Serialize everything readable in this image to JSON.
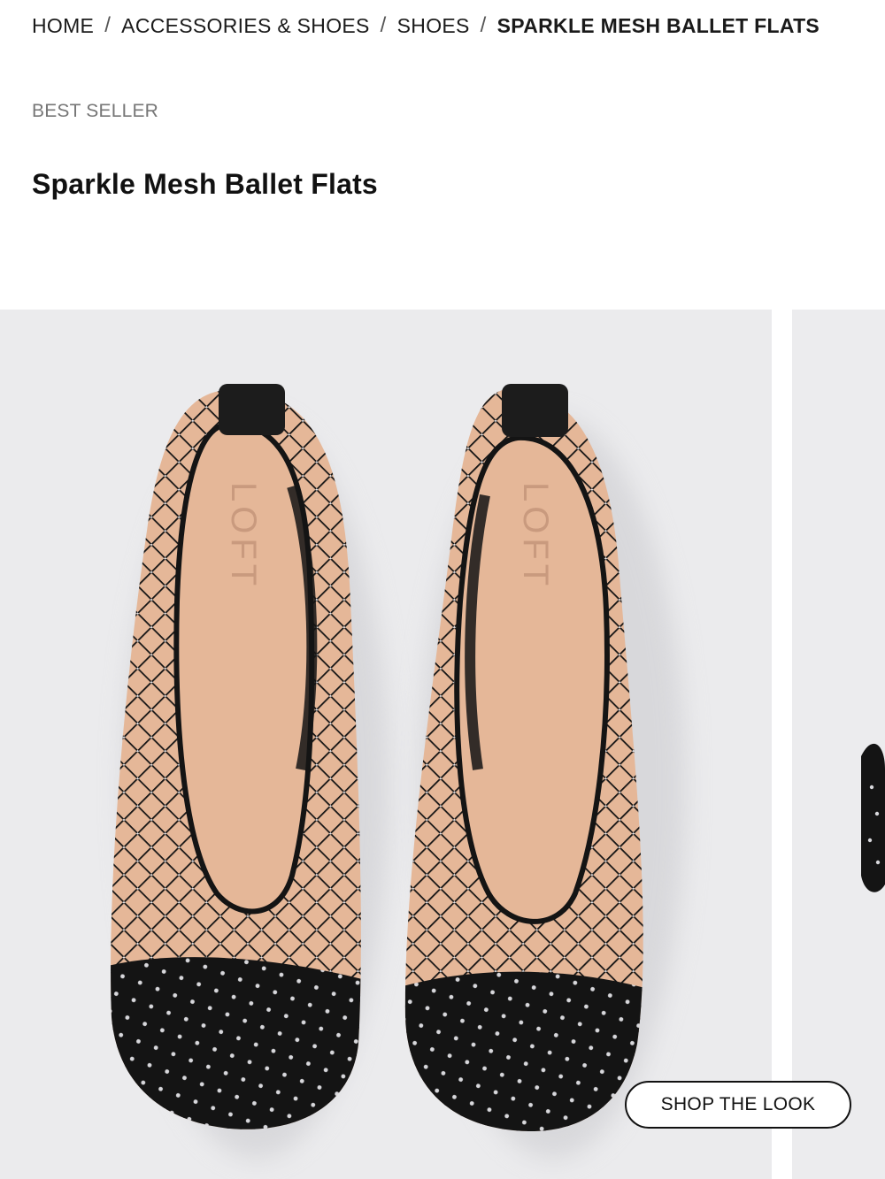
{
  "breadcrumb": {
    "items": [
      "HOME",
      "ACCESSORIES & SHOES",
      "SHOES"
    ],
    "separator": "/",
    "current": "SPARKLE MESH BALLET FLATS"
  },
  "product": {
    "badge": "BEST SELLER",
    "title": "Sparkle Mesh Ballet Flats"
  },
  "gallery": {
    "images": [
      {
        "alt": "black rhinestone mesh ballet flats",
        "insole_text": "LOFT"
      },
      {
        "alt": "black rhinestone mesh ballet flat side view"
      }
    ],
    "shop_the_look": "SHOP THE LOOK"
  },
  "colors": {
    "text": "#1a1a1a",
    "badge": "#767676",
    "image_background": "#ebebed",
    "shoe_black": "#141414",
    "insole": "#e5b798"
  }
}
